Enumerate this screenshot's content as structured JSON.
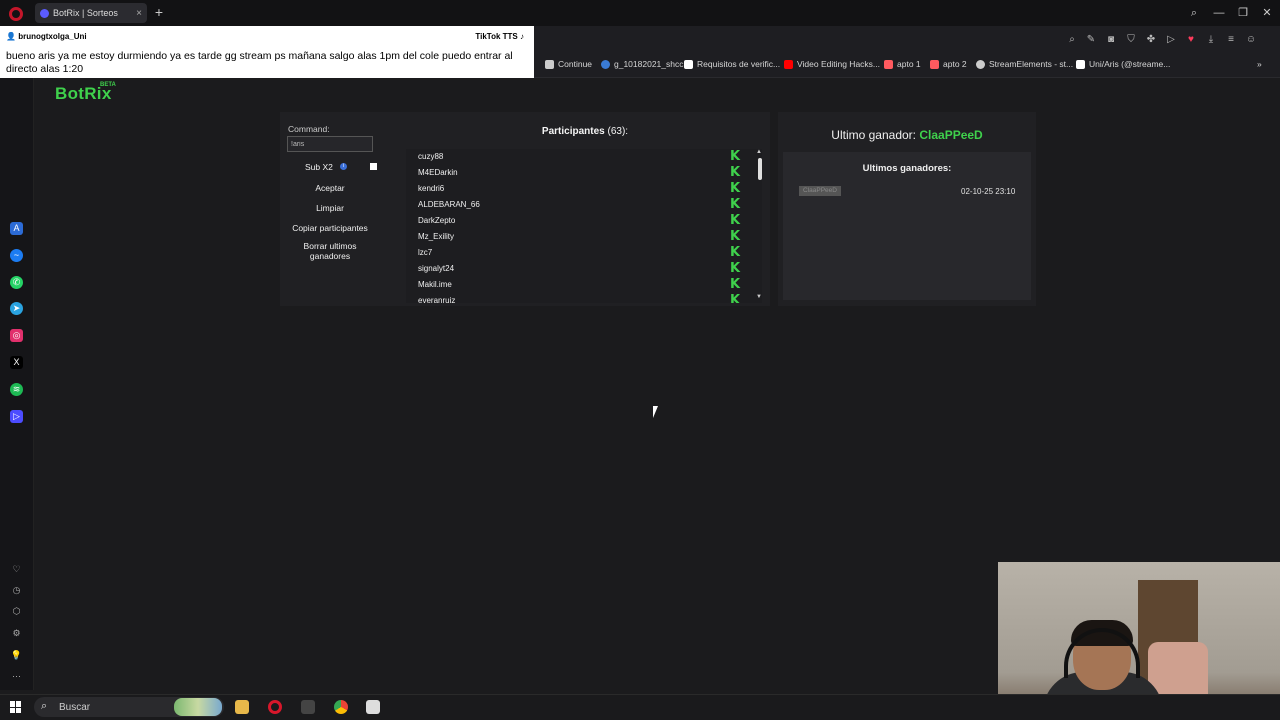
{
  "browser": {
    "tab_title": "BotRix | Sorteos",
    "tab_close": "×",
    "new_tab": "+",
    "window_controls": {
      "search": "⌕",
      "minimize": "—",
      "restore": "❐",
      "close": "✕"
    },
    "bookmarks": [
      {
        "label": "Continue",
        "color": "#cccccc"
      },
      {
        "label": "g_10182021_shcc",
        "color": "#3a7bd5"
      },
      {
        "label": "Requisitos de verific...",
        "color": "#ffffff"
      },
      {
        "label": "Video Editing Hacks...",
        "color": "#ff0000"
      },
      {
        "label": "apto 1",
        "color": "#ff5a5f"
      },
      {
        "label": "apto 2",
        "color": "#ff5a5f"
      },
      {
        "label": "StreamElements - st...",
        "color": "#cccccc"
      },
      {
        "label": "Uni/Aris (@streame...",
        "color": "#ffffff"
      }
    ],
    "bookmarks_more": "»"
  },
  "tts": {
    "username": "brunogtxolga_Uni",
    "brand": "TikTok TTS",
    "message": "bueno aris ya me estoy durmiendo ya es tarde gg stream ps mañana salgo alas 1pm del cole puedo entrar al directo alas 1:20"
  },
  "app": {
    "logo": "BotRix",
    "logo_badge": "BETA"
  },
  "controls": {
    "command_label": "Command:",
    "command_value": "!aris",
    "sub_x2_label": "Sub X2",
    "sub_x2_info": "i",
    "accept_label": "Aceptar",
    "clear_label": "Limpiar",
    "copy_label": "Copiar participantes",
    "delete_winners_label": "Borrar ultimos ganadores"
  },
  "participants": {
    "title": "Participantes",
    "count": "(63):",
    "platform_badge": "K",
    "list": [
      "cuzy88",
      "M4EDarkin",
      "kendri6",
      "ALDEBARAN_66",
      "DarkZepto",
      "Mz_Exility",
      "lzc7",
      "signalyt24",
      "Makil.ime",
      "everanruiz"
    ],
    "scroll_up": "▲",
    "scroll_down": "▼"
  },
  "winners": {
    "last_winner_label": "Ultimo ganador:",
    "last_winner_name": "ClaaPPeeD",
    "recent_title": "Ultimos ganadores:",
    "recent": [
      {
        "name": "ClaaPPeeD",
        "date": "02-10-25 23:10"
      }
    ]
  },
  "taskbar": {
    "search_placeholder": "Buscar",
    "search_icon": "⌕"
  },
  "colors": {
    "accent_green": "#3fd14c",
    "background": "#1b1b1d",
    "panel": "#202023"
  }
}
